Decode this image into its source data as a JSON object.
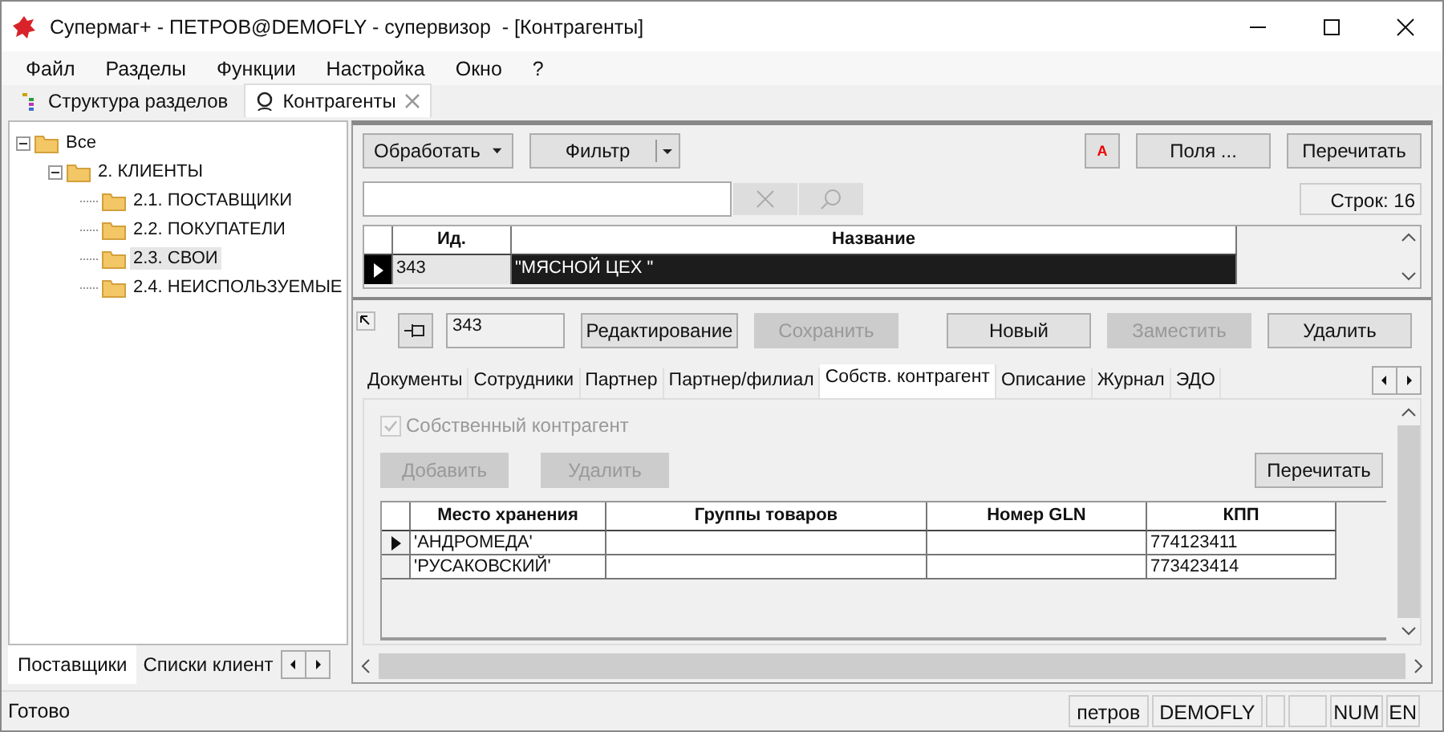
{
  "window": {
    "title": "Супермаг+ - ПЕТРОВ@DEMOFLY - супервизор  - [Контрагенты]"
  },
  "menu": [
    "Файл",
    "Разделы",
    "Функции",
    "Настройка",
    "Окно",
    "?"
  ],
  "doc_tabs": [
    {
      "label": "Структура разделов",
      "selected": false,
      "closable": false
    },
    {
      "label": "Контрагенты",
      "selected": true,
      "closable": true
    }
  ],
  "tree": [
    {
      "label": "Все",
      "expanded": true,
      "selected": false,
      "children": [
        {
          "label": "2. КЛИЕНТЫ",
          "expanded": true,
          "selected": false,
          "children": [
            {
              "label": "2.1. ПОСТАВЩИКИ",
              "selected": false
            },
            {
              "label": "2.2. ПОКУПАТЕЛИ",
              "selected": false
            },
            {
              "label": "2.3. СВОИ",
              "selected": true
            },
            {
              "label": "2.4. НЕИСПОЛЬЗУЕМЫЕ",
              "selected": false
            }
          ]
        }
      ]
    }
  ],
  "left_tabs": [
    {
      "label": "Поставщики",
      "selected": true
    },
    {
      "label": "Списки клиент",
      "selected": false
    }
  ],
  "toolbar": {
    "process_button": "Обработать",
    "filter_button": "Фильтр",
    "font_button": "A",
    "fields_button": "Поля ...",
    "reload_button": "Перечитать"
  },
  "row_count": "Строк: 16",
  "main_grid": {
    "columns": [
      "Ид.",
      "Название"
    ],
    "rows": [
      {
        "cells": [
          "343",
          "\"МЯСНОЙ ЦЕХ \""
        ],
        "selected": true
      }
    ]
  },
  "detail": {
    "id_value": "343",
    "buttons": [
      {
        "label": "Редактирование",
        "disabled": false
      },
      {
        "label": "Сохранить",
        "disabled": true
      },
      {
        "label": "Новый",
        "disabled": false
      },
      {
        "label": "Заместить",
        "disabled": true
      },
      {
        "label": "Удалить",
        "disabled": false
      }
    ]
  },
  "detail_tabs": [
    {
      "label": "Документы",
      "selected": false
    },
    {
      "label": "Сотрудники",
      "selected": false
    },
    {
      "label": "Партнер",
      "selected": false
    },
    {
      "label": "Партнер/филиал",
      "selected": false
    },
    {
      "label": "Собств. контрагент",
      "selected": true
    },
    {
      "label": "Описание",
      "selected": false
    },
    {
      "label": "Журнал",
      "selected": false
    },
    {
      "label": "ЭДО",
      "selected": false
    }
  ],
  "own_tab": {
    "checkbox": {
      "label": "Собственный контрагент",
      "checked": true,
      "disabled": true
    },
    "buttons": [
      {
        "label": "Добавить",
        "disabled": true
      },
      {
        "label": "Удалить",
        "disabled": true
      }
    ],
    "reload_button": "Перечитать",
    "table": {
      "columns": [
        "Место хранения",
        "Группы товаров",
        "Номер GLN",
        "КПП"
      ],
      "rows": [
        {
          "cells": [
            "'АНДРОМЕДА'",
            "",
            "",
            "774123411"
          ],
          "selected": true
        },
        {
          "cells": [
            "'РУСАКОВСКИЙ'",
            "",
            "",
            "773423414"
          ],
          "selected": false
        }
      ]
    }
  },
  "status_bar": {
    "message": "Готово",
    "user_panels": [
      "петров",
      "DEMOFLY"
    ],
    "indicators": [
      "NUM",
      "EN"
    ]
  }
}
